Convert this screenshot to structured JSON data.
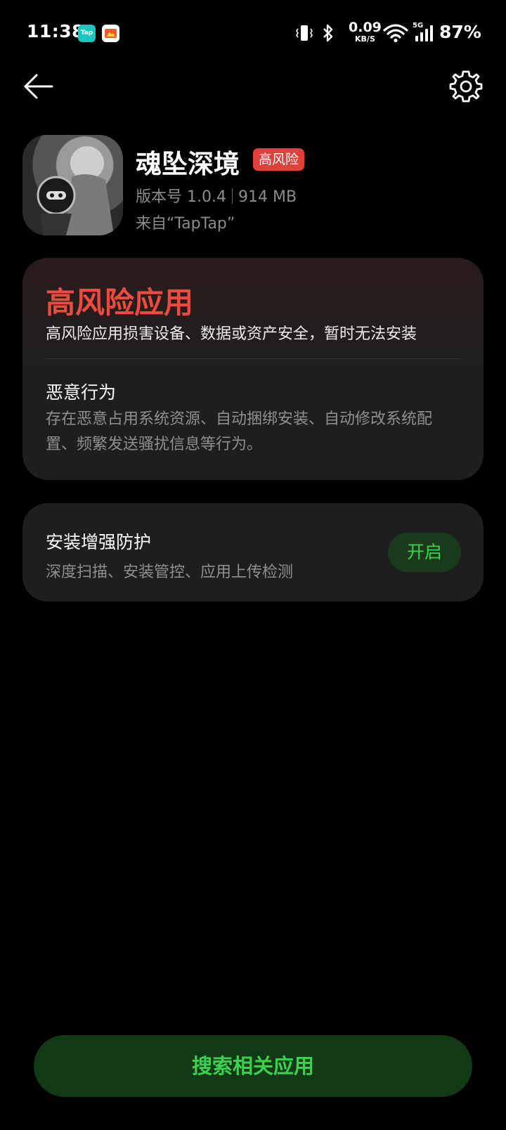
{
  "status_bar": {
    "time": "11:38",
    "taptap_label": "Tap",
    "net_speed_value": "0.09",
    "net_speed_unit": "KB/S",
    "network_label": "5G",
    "battery": "87%"
  },
  "header": {
    "back_icon": "arrow-left-icon",
    "settings_icon": "gear-icon"
  },
  "app": {
    "name": "魂坠深境",
    "risk_badge": "高风险",
    "version": "版本号 1.0.4",
    "size": "914 MB",
    "source": "来自“TapTap”"
  },
  "risk_card": {
    "title": "高风险应用",
    "description": "高风险应用损害设备、数据或资产安全，暂时无法安装",
    "behavior_title": "恶意行为",
    "behavior_description": "存在恶意占用系统资源、自动捆绑安装、自动修改系统配置、频繁发送骚扰信息等行为。"
  },
  "protect_card": {
    "title": "安装增强防护",
    "description": "深度扫描、安装管控、应用上传检测",
    "enable_label": "开启"
  },
  "footer": {
    "search_label": "搜索相关应用"
  },
  "colors": {
    "background": "#000000",
    "danger": "#ef4a3f",
    "accent_green": "#3dd04f",
    "card": "#1e1e1e"
  }
}
